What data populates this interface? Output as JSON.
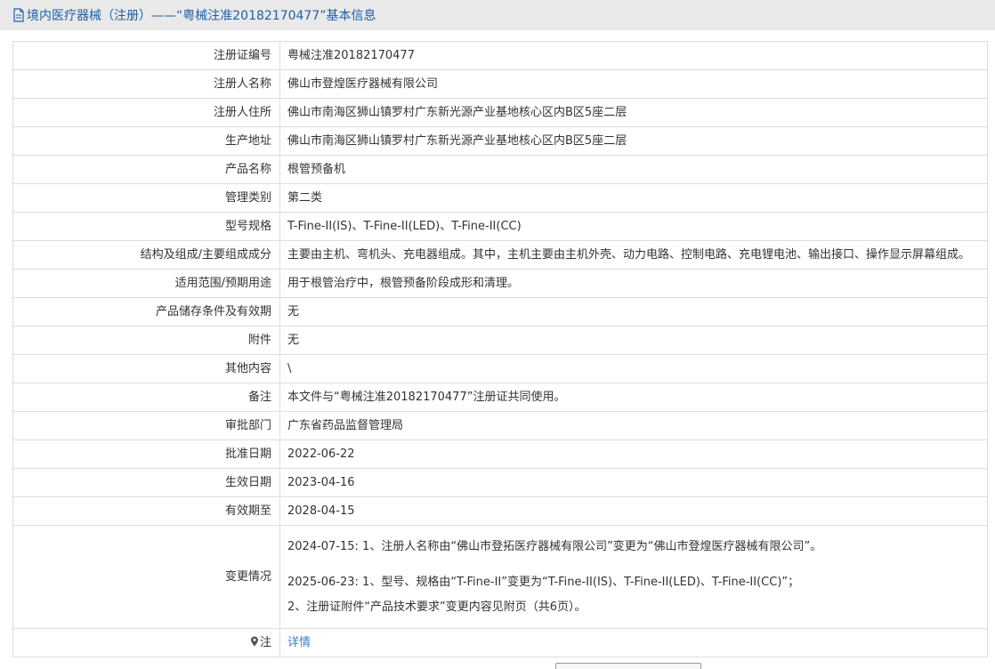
{
  "header": {
    "title": "境内医疗器械（注册）——“粤械注准20182170477”基本信息"
  },
  "rows": [
    {
      "key": "注册证编号",
      "value": "粤械注准20182170477"
    },
    {
      "key": "注册人名称",
      "value": "佛山市登煌医疗器械有限公司"
    },
    {
      "key": "注册人住所",
      "value": "佛山市南海区狮山镇罗村广东新光源产业基地核心区内B区5座二层"
    },
    {
      "key": "生产地址",
      "value": "佛山市南海区狮山镇罗村广东新光源产业基地核心区内B区5座二层"
    },
    {
      "key": "产品名称",
      "value": "根管预备机"
    },
    {
      "key": "管理类别",
      "value": "第二类"
    },
    {
      "key": "型号规格",
      "value": "T-Fine-II(IS)、T-Fine-II(LED)、T-Fine-II(CC)"
    },
    {
      "key": "结构及组成/主要组成成分",
      "value": "主要由主机、弯机头、充电器组成。其中，主机主要由主机外壳、动力电路、控制电路、充电锂电池、输出接口、操作显示屏幕组成。"
    },
    {
      "key": "适用范围/预期用途",
      "value": "用于根管治疗中，根管预备阶段成形和清理。"
    },
    {
      "key": "产品储存条件及有效期",
      "value": "无"
    },
    {
      "key": "附件",
      "value": "无"
    },
    {
      "key": "其他内容",
      "value": "\\"
    },
    {
      "key": "备注",
      "value": "本文件与“粤械注准20182170477”注册证共同使用。"
    },
    {
      "key": "审批部门",
      "value": "广东省药品监督管理局"
    },
    {
      "key": "批准日期",
      "value": "2022-06-22"
    },
    {
      "key": "生效日期",
      "value": "2023-04-16"
    },
    {
      "key": "有效期至",
      "value": "2028-04-15"
    }
  ],
  "changes": {
    "key": "变更情况",
    "line1": "2024-07-15: 1、注册人名称由“佛山市登拓医疗器械有限公司”变更为“佛山市登煌医疗器械有限公司”。",
    "line2": "2025-06-23: 1、型号、规格由“T-Fine-II”变更为“T-Fine-II(IS)、T-Fine-II(LED)、T-Fine-II(CC)”；",
    "line3": "2、注册证附件“产品技术要求”变更内容见附页（共6页）。"
  },
  "note": {
    "key": "注",
    "link_label": "详情"
  },
  "icons": {
    "title": "document-icon",
    "note": "location-pin-icon"
  },
  "colors": {
    "title_text": "#1f5fa6",
    "link": "#3a7fc9",
    "header_bg": "#e9e9e9",
    "border": "#dddddd"
  }
}
